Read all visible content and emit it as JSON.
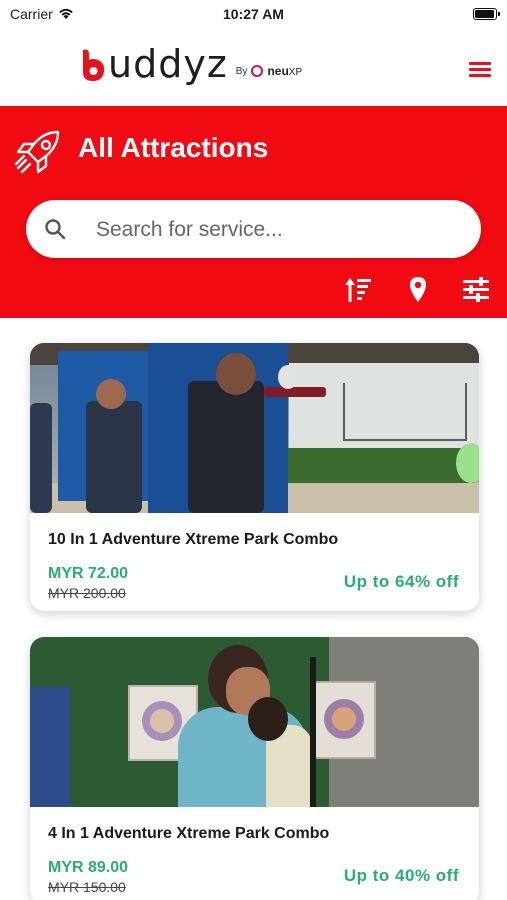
{
  "status_bar": {
    "carrier": "Carrier",
    "time": "10:27 AM"
  },
  "header": {
    "logo_text": "uddyz",
    "logo_by": "By",
    "brand_neu": "neu",
    "brand_xp": "XP"
  },
  "hero": {
    "title": "All Attractions",
    "search_placeholder": "Search for service..."
  },
  "colors": {
    "primary_red": "#f20a12",
    "accent_green": "#27ae73"
  },
  "icons": [
    "rocket-icon",
    "search-icon",
    "sort-icon",
    "location-pin-icon",
    "filter-sliders-icon",
    "hamburger-menu-icon"
  ],
  "attractions": [
    {
      "title": "10 In 1 Adventure Xtreme Park Combo",
      "price": "MYR 72.00",
      "original_price": "MYR 200.00",
      "discount": "Up to 64% off"
    },
    {
      "title": "4 In 1 Adventure Xtreme Park Combo",
      "price": "MYR 89.00",
      "original_price": "MYR 150.00",
      "discount": "Up to 40% off"
    }
  ]
}
